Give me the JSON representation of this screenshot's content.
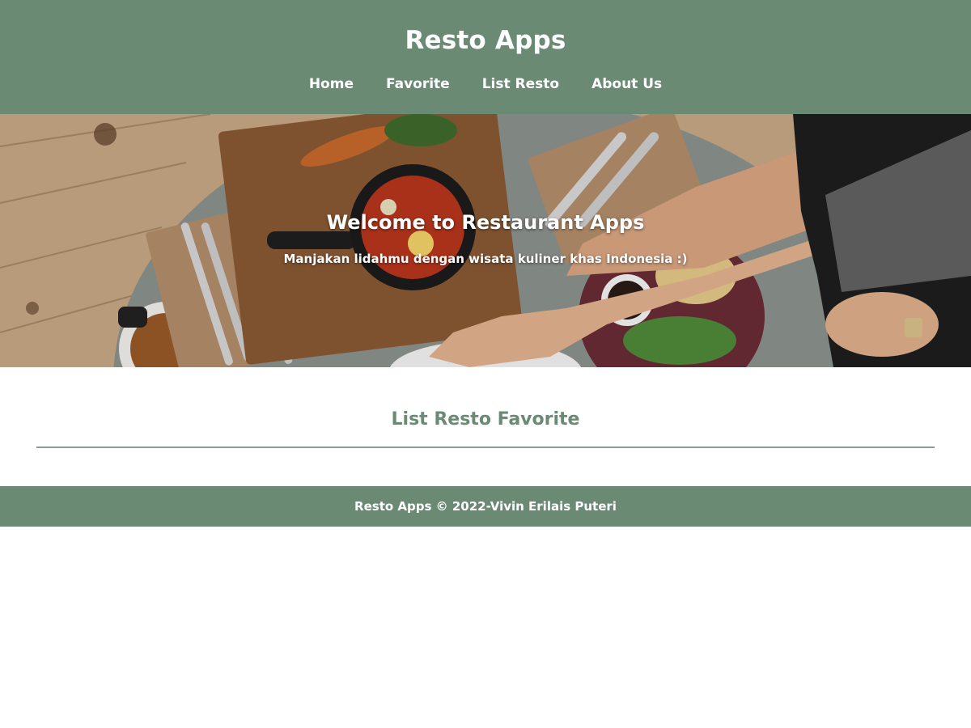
{
  "header": {
    "title": "Resto Apps",
    "nav": [
      {
        "label": "Home"
      },
      {
        "label": "Favorite"
      },
      {
        "label": "List Resto"
      },
      {
        "label": "About Us"
      }
    ]
  },
  "hero": {
    "title": "Welcome to Restaurant Apps",
    "subtitle": "Manjakan lidahmu dengan wisata kuliner khas Indonesia :)"
  },
  "main": {
    "section_title": "List Resto Favorite"
  },
  "footer": {
    "text": "Resto Apps © 2022-Vivin Erilais Puteri"
  },
  "colors": {
    "primary": "#6b8a74",
    "background": "#ffffff",
    "divider": "#8c9a94"
  }
}
